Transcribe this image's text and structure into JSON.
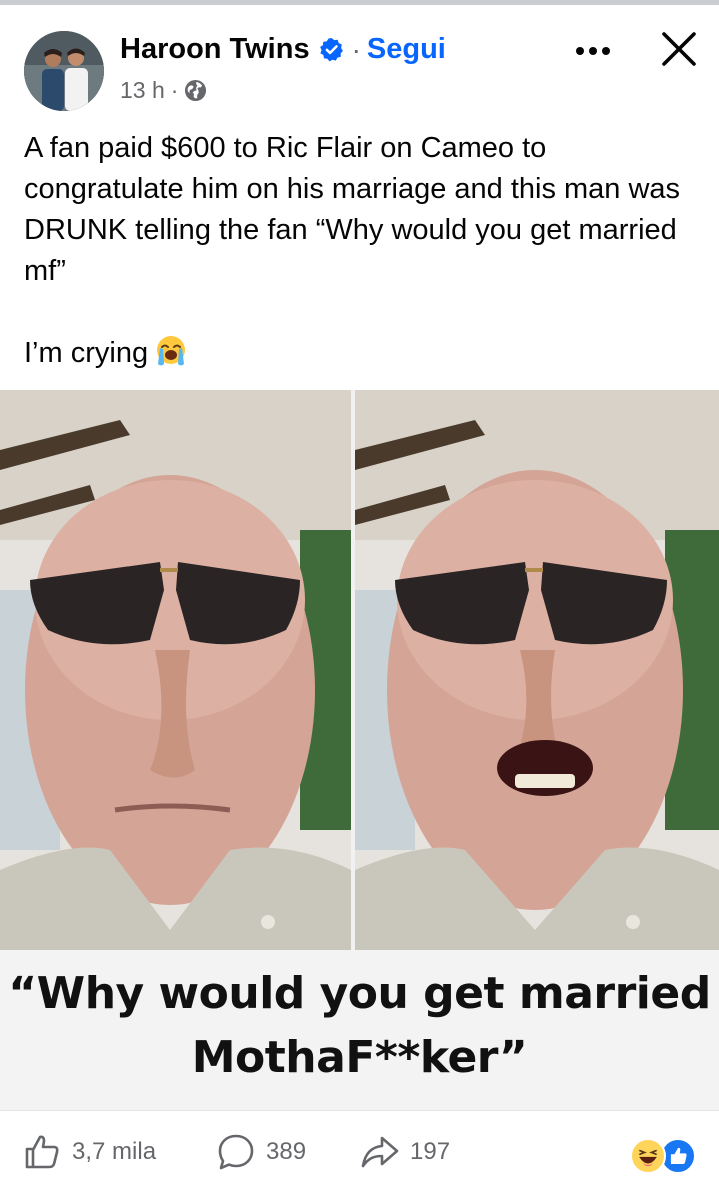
{
  "post": {
    "author": "Haroon Twins",
    "follow_label": "Segui",
    "separator_dot": "·",
    "time": "13 h",
    "text_lines": [
      "A fan paid $600 to Ric Flair on Cameo to congratulate him on his marriage and this man was DRUNK telling the fan “Why would you get married mf”",
      "I’m crying"
    ]
  },
  "media": {
    "caption_line1": "“Why would you get married",
    "caption_line2": "MothaF**ker”"
  },
  "footer": {
    "likes": "3,7 mila",
    "comments": "389",
    "shares": "197"
  },
  "icons": {
    "verified": "verified-badge-icon",
    "privacy": "globe-icon",
    "more": "more-options-icon",
    "close": "close-icon",
    "like": "thumbs-up-icon",
    "comment": "comment-icon",
    "share": "share-icon",
    "reactions": [
      "haha-reaction-icon",
      "like-reaction-icon"
    ]
  },
  "colors": {
    "brand_blue": "#0866ff",
    "secondary_text": "#65676b",
    "primary_text": "#050505"
  }
}
